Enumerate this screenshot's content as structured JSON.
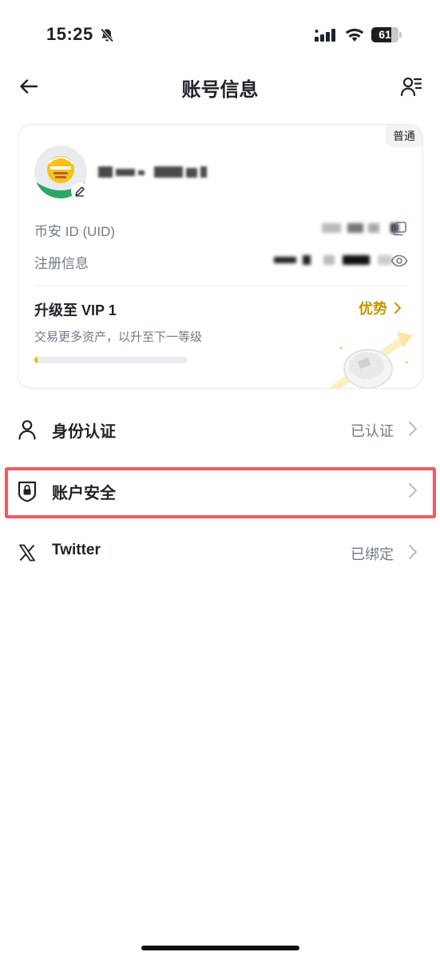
{
  "status_bar": {
    "time": "15:25",
    "battery_level": "61",
    "icons": [
      "bell-muted-icon",
      "signal-icon",
      "wifi-icon",
      "battery-icon"
    ]
  },
  "nav": {
    "title": "账号信息",
    "back_icon": "arrow-left-icon",
    "profile_menu_icon": "user-list-icon"
  },
  "account_card": {
    "tier_badge": "普通",
    "uid_label": "币安 ID (UID)",
    "registration_label": "注册信息",
    "vip": {
      "title": "升级至 VIP 1",
      "benefits_label": "优势",
      "description": "交易更多资产，以升至下一等级",
      "progress_percent": 2
    }
  },
  "menu": [
    {
      "label": "身份认证",
      "value": "已认证",
      "icon": "person-icon"
    },
    {
      "label": "账户安全",
      "value": "",
      "icon": "shield-lock-icon"
    },
    {
      "label": "Twitter",
      "value": "已绑定",
      "icon": "x-logo-icon"
    }
  ],
  "colors": {
    "accent": "#F0B90B",
    "accent_text": "#C99400",
    "highlight_border": "#EF5B63",
    "secondary_text": "#707A8A"
  }
}
